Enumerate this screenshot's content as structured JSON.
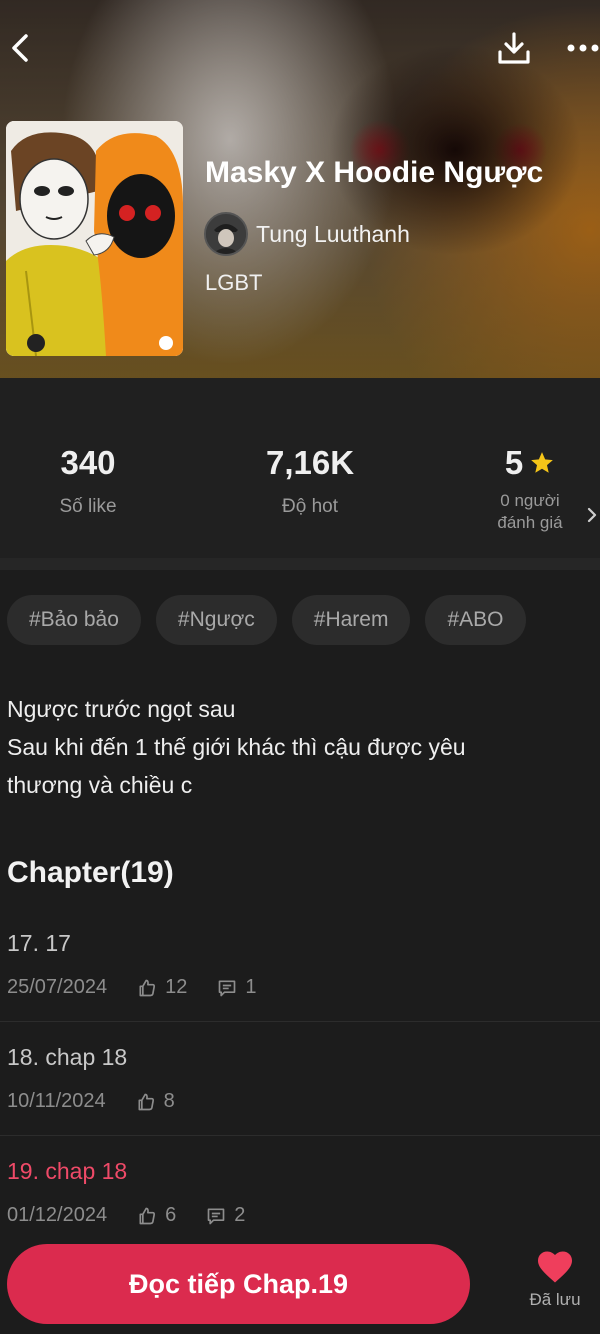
{
  "header": {
    "icons": {
      "back": "chevron-left-icon",
      "download": "download-icon",
      "more": "more-dots-icon"
    }
  },
  "story": {
    "title": "Masky X Hoodie Ngược",
    "author": "Tung Luuthanh",
    "genre": "LGBT"
  },
  "stats": {
    "likes_value": "340",
    "likes_label": "Số like",
    "hot_value": "7,16K",
    "hot_label": "Độ hot",
    "rating_value": "5",
    "rating_label_line1": "0 người",
    "rating_label_line2": "đánh giá",
    "star_color": "#f5c518"
  },
  "tags": [
    "#Bảo bảo",
    "#Ngược",
    "#Harem",
    "#ABO"
  ],
  "description": {
    "line1": "Ngược trước ngọt sau",
    "line2": "Sau khi đến 1 thế giới khác thì cậu được yêu",
    "line3": "thương và chiều c"
  },
  "chapters": {
    "heading": "Chapter(19)",
    "items": [
      {
        "title": "17. 17",
        "date": "25/07/2024",
        "likes": "12",
        "comments": "1",
        "current": false
      },
      {
        "title": "18. chap 18",
        "date": "10/11/2024",
        "likes": "8",
        "comments": "",
        "current": false
      },
      {
        "title": "19. chap 18",
        "date": "01/12/2024",
        "likes": "6",
        "comments": "2",
        "current": true
      }
    ],
    "current_color": "#ef4a68"
  },
  "bottom": {
    "continue_label": "Đọc tiếp Chap.19",
    "saved_label": "Đã lưu",
    "accent_color": "#db2b4e"
  }
}
